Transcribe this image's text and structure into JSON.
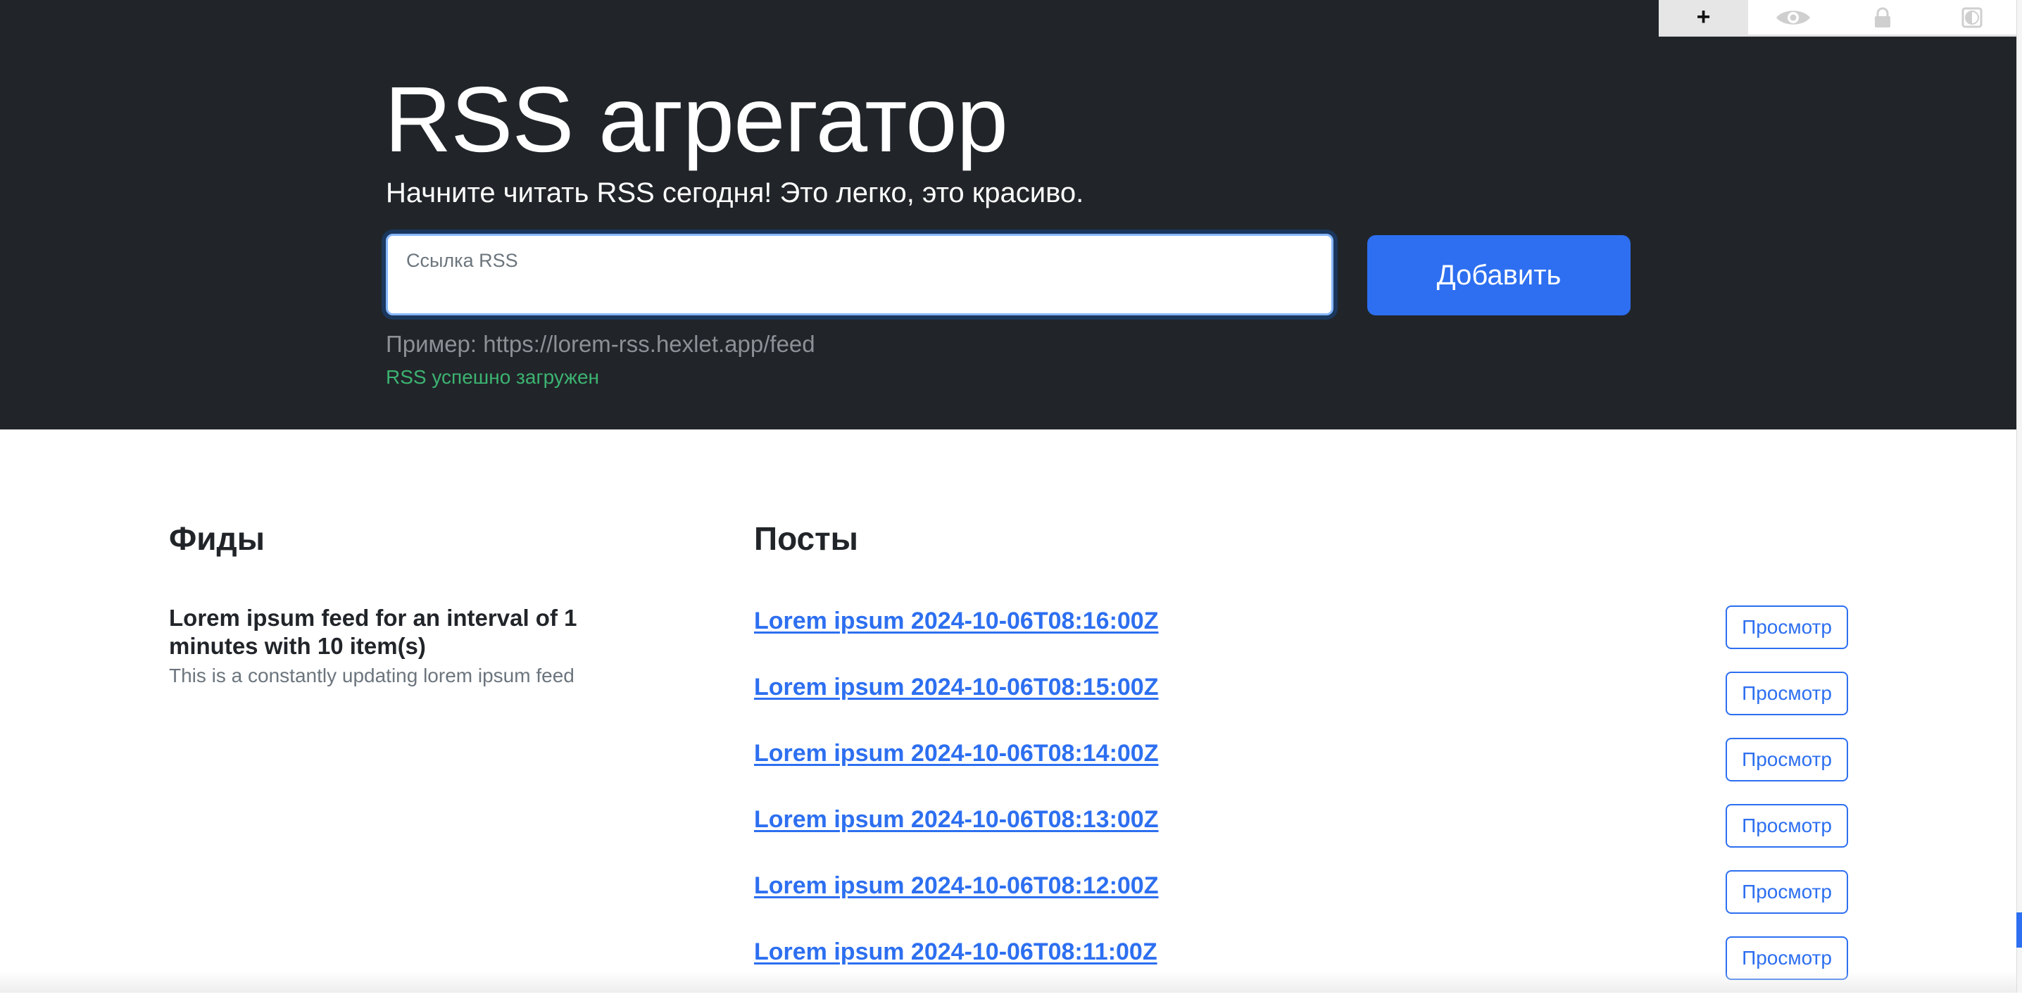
{
  "hero": {
    "title": "RSS агрегатор",
    "lead": "Начните читать RSS сегодня! Это легко, это красиво.",
    "input_label": "Ссылка RSS",
    "input_value": "",
    "add_button_label": "Добавить",
    "hint": "Пример: https://lorem-rss.hexlet.app/feed",
    "feedback": "RSS успешно загружен"
  },
  "extension_toolbar": {
    "buttons": [
      {
        "icon": "plus-icon",
        "glyph": "+",
        "active": true
      },
      {
        "icon": "eye-icon",
        "glyph": "👁",
        "active": false
      },
      {
        "icon": "lock-icon",
        "glyph": "🔒",
        "active": false
      },
      {
        "icon": "contrast-icon",
        "glyph": "◧",
        "active": false
      }
    ]
  },
  "feeds": {
    "heading": "Фиды",
    "items": [
      {
        "title": "Lorem ipsum feed for an interval of 1 minutes with 10 item(s)",
        "description": "This is a constantly updating lorem ipsum feed"
      }
    ]
  },
  "posts": {
    "heading": "Посты",
    "preview_label": "Просмотр",
    "items": [
      {
        "title": "Lorem ipsum 2024-10-06T08:16:00Z"
      },
      {
        "title": "Lorem ipsum 2024-10-06T08:15:00Z"
      },
      {
        "title": "Lorem ipsum 2024-10-06T08:14:00Z"
      },
      {
        "title": "Lorem ipsum 2024-10-06T08:13:00Z"
      },
      {
        "title": "Lorem ipsum 2024-10-06T08:12:00Z"
      },
      {
        "title": "Lorem ipsum 2024-10-06T08:11:00Z"
      }
    ]
  },
  "colors": {
    "hero_bg": "#212529",
    "primary": "#2d6ff0",
    "success": "#3cb371",
    "muted": "#6c757d"
  }
}
